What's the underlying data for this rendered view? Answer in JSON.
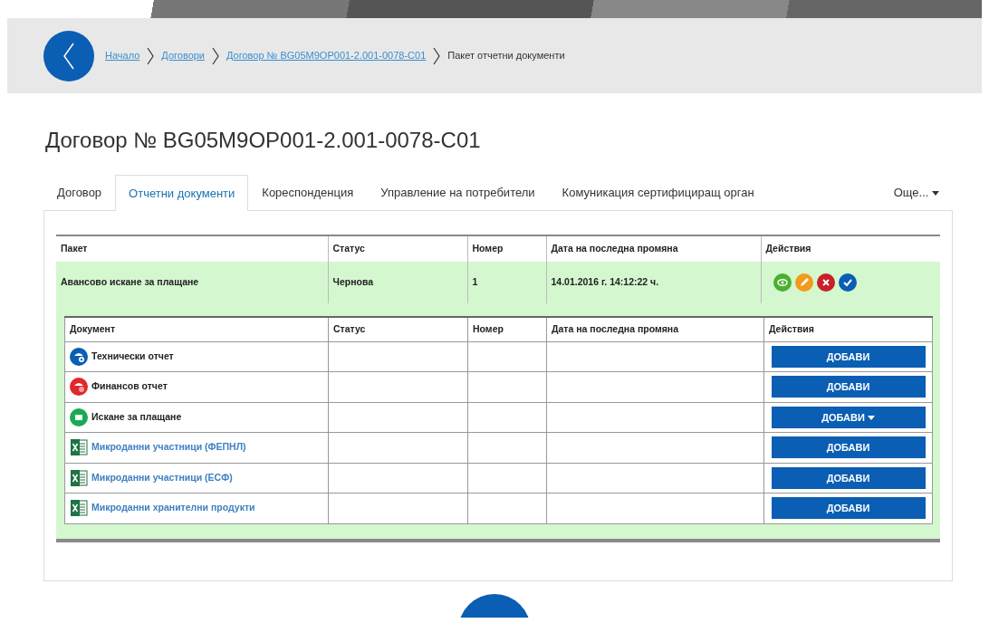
{
  "breadcrumb": [
    {
      "label": "Начало",
      "link": true
    },
    {
      "label": "Договори",
      "link": true
    },
    {
      "label": "Договор № BG05M9OP001-2.001-0078-C01",
      "link": true
    },
    {
      "label": "Пакет отчетни документи",
      "link": false
    }
  ],
  "title": "Договор № BG05M9OP001-2.001-0078-C01",
  "tabs": [
    {
      "label": "Договор",
      "selected": false
    },
    {
      "label": "Отчетни документи",
      "selected": true
    },
    {
      "label": "Кореспонденция",
      "selected": false
    },
    {
      "label": "Управление на потребители",
      "selected": false
    },
    {
      "label": "Комуникация сертифициращ орган",
      "selected": false
    }
  ],
  "more_tab": {
    "label": "Още..."
  },
  "package_table": {
    "columns": [
      "Пакет",
      "Статус",
      "Номер",
      "Дата на последна промяна",
      "Действия"
    ],
    "rows": [
      {
        "package": "Авансово искане за плащане",
        "status": "Чернова",
        "number": "1",
        "modified": "14.01.2016 г. 14:12:22 ч.",
        "actions": [
          {
            "kind": "view"
          },
          {
            "kind": "edit"
          },
          {
            "kind": "delete"
          },
          {
            "kind": "submit"
          }
        ]
      }
    ]
  },
  "documents_table": {
    "columns": [
      "Документ",
      "Статус",
      "Номер",
      "Дата на последна промяна",
      "Действия"
    ],
    "rows": [
      {
        "kind": "technical",
        "name": "Технически отчет",
        "button": "ДОБАВИ",
        "dropdown": false
      },
      {
        "kind": "financial",
        "name": "Финансов отчет",
        "button": "ДОБАВИ",
        "dropdown": false
      },
      {
        "kind": "payment",
        "name": "Искане за плащане",
        "button": "ДОБАВИ",
        "dropdown": true
      },
      {
        "kind": "spreadsheet",
        "name": "Микроданни участници (ФЕПНЛ)",
        "button": "ДОБАВИ",
        "dropdown": false
      },
      {
        "kind": "spreadsheet",
        "name": "Микроданни участници (ЕСФ)",
        "button": "ДОБАВИ",
        "dropdown": false
      },
      {
        "kind": "spreadsheet",
        "name": "Микроданни хранителни продукти",
        "button": "ДОБАВИ",
        "dropdown": false
      }
    ]
  }
}
